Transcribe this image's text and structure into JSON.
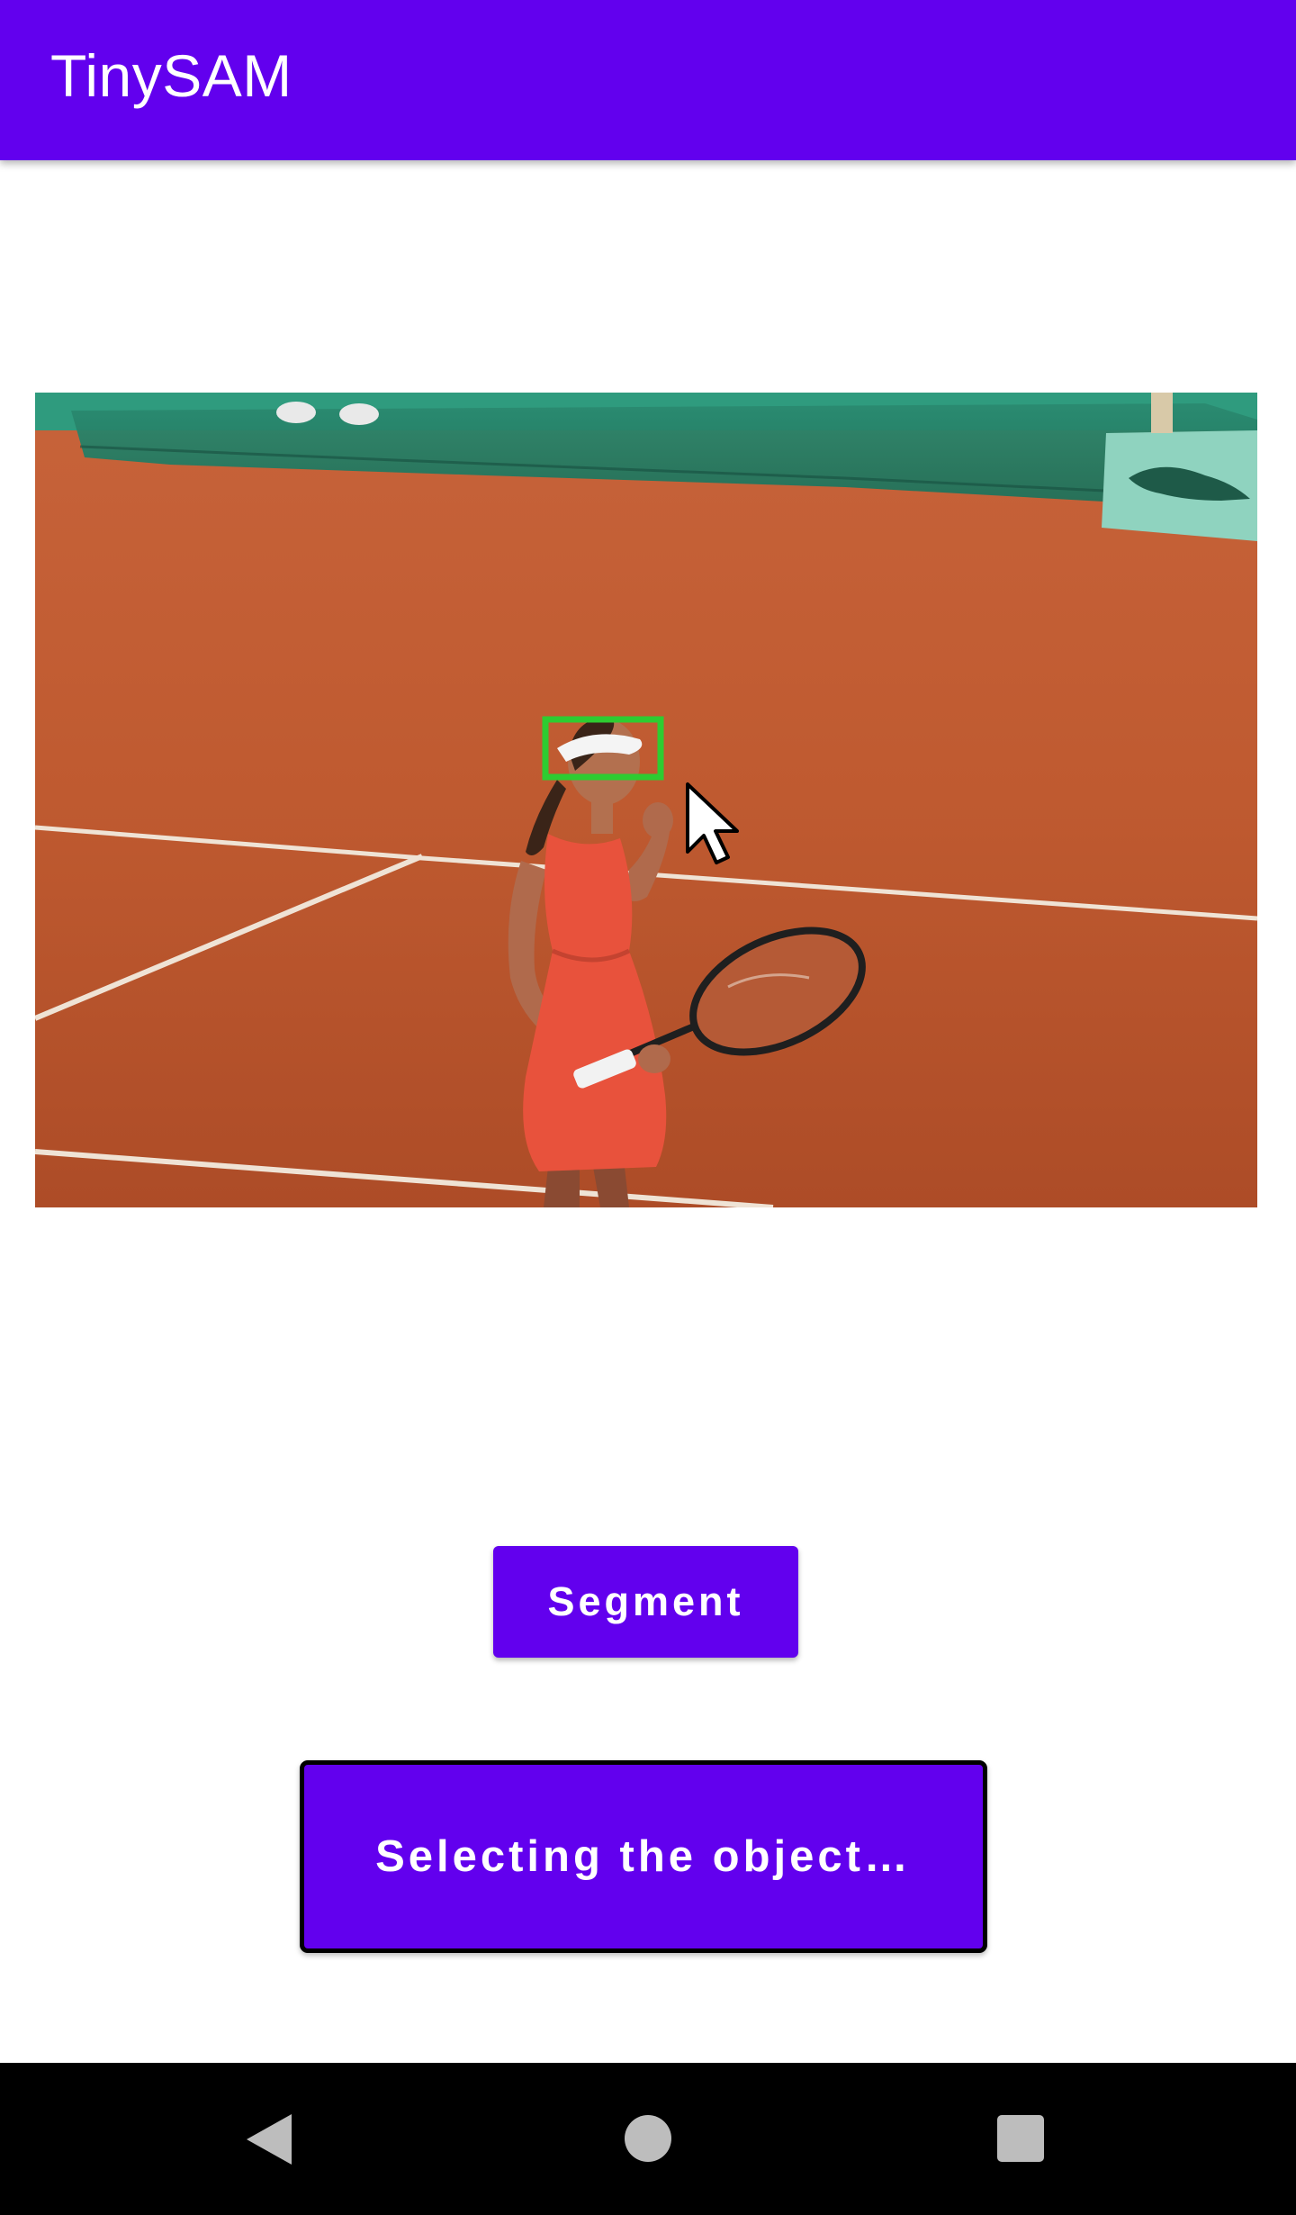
{
  "app_bar": {
    "title": "TinySAM"
  },
  "image": {
    "icon": "tennis-photo",
    "selection_box_color": "#2ecc31"
  },
  "actions": {
    "segment_label": "Segment"
  },
  "status": {
    "text": "Selecting the object…"
  },
  "colors": {
    "primary": "#6200ee",
    "nav_bar": "#000000",
    "nav_icons": "#bdbdbd"
  },
  "nav": {
    "back_icon": "back-icon",
    "home_icon": "home-icon",
    "recents_icon": "recents-icon"
  }
}
